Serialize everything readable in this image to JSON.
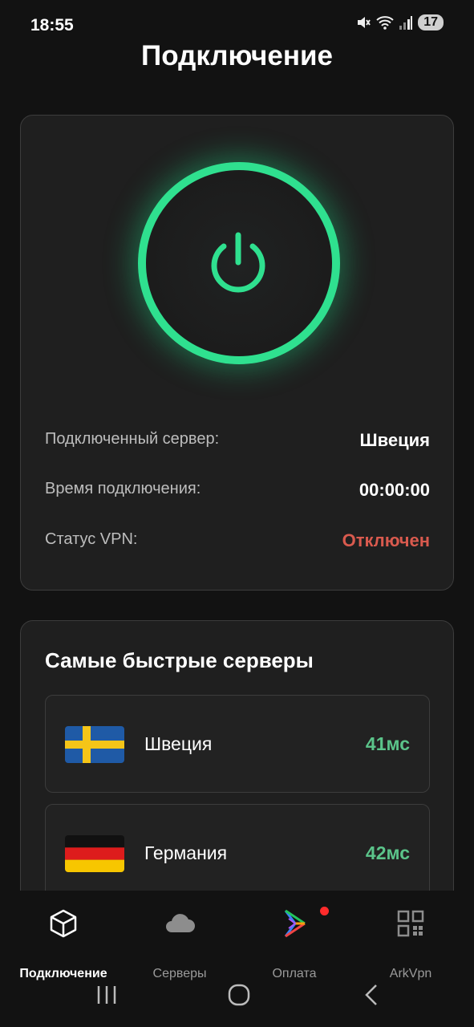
{
  "status_bar": {
    "time": "18:55",
    "battery": "17"
  },
  "title": "Подключение",
  "connection": {
    "rows": [
      {
        "label": "Подключенный сервер:",
        "value": "Швеция"
      },
      {
        "label": "Время подключения:",
        "value": "00:00:00"
      },
      {
        "label": "Статус VPN:",
        "value": "Отключен"
      }
    ],
    "status_color": "#d95a4e",
    "power_color": "#2fe08f"
  },
  "fastest": {
    "title": "Самые быстрые серверы",
    "servers": [
      {
        "name": "Швеция",
        "ping": "41мс",
        "flag": "sweden-flag"
      },
      {
        "name": "Германия",
        "ping": "42мс",
        "flag": "germany-flag"
      }
    ]
  },
  "nav": {
    "items": [
      {
        "label": "Подключение",
        "icon": "cube-icon"
      },
      {
        "label": "Серверы",
        "icon": "cloud-icon"
      },
      {
        "label": "Оплата",
        "icon": "play-store-icon"
      },
      {
        "label": "ArkVpn",
        "icon": "grid-icon"
      }
    ]
  }
}
